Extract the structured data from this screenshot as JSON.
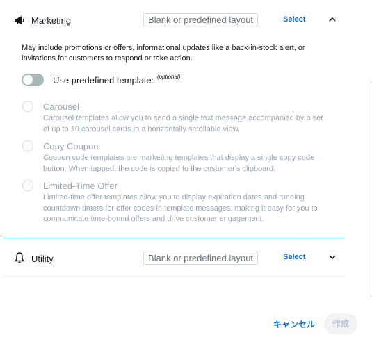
{
  "marketing": {
    "title": "Marketing",
    "layout_placeholder": "Blank or predefined layout",
    "select_label": "Select",
    "icon": "megaphone-icon",
    "description": "May include promotions or offers, informational updates like a back-in-stock alert, or invitations for customers to respond or take action.",
    "toggle_label": "Use predefined template:",
    "toggle_optional": "(optional)",
    "toggle_on": false,
    "options": [
      {
        "title": "Carousel",
        "description": "Carousel templates allow you to send a single text message accompanied by a set of up to 10 carousel cards in a horizontally scrollable view."
      },
      {
        "title": "Copy Coupon",
        "description": "Coupon code templates are marketing templates that display a single copy code button. When tapped, the code is copied to the customer's clipboard."
      },
      {
        "title": "Limited-Time Offer",
        "description": "Limited-time offer templates allow you to display expiration dates and running countdown timers for offer codes in template messages, making it easy for you to communicate time-bound offers and drive customer engagement."
      }
    ]
  },
  "utility": {
    "title": "Utility",
    "layout_placeholder": "Blank or predefined layout",
    "select_label": "Select",
    "icon": "bell-icon"
  },
  "footer": {
    "cancel_label": "キャンセル",
    "create_label": "作成"
  },
  "colors": {
    "link": "#0972d3",
    "disabled_text": "#9ba7b6",
    "divider": "#0972d3"
  }
}
